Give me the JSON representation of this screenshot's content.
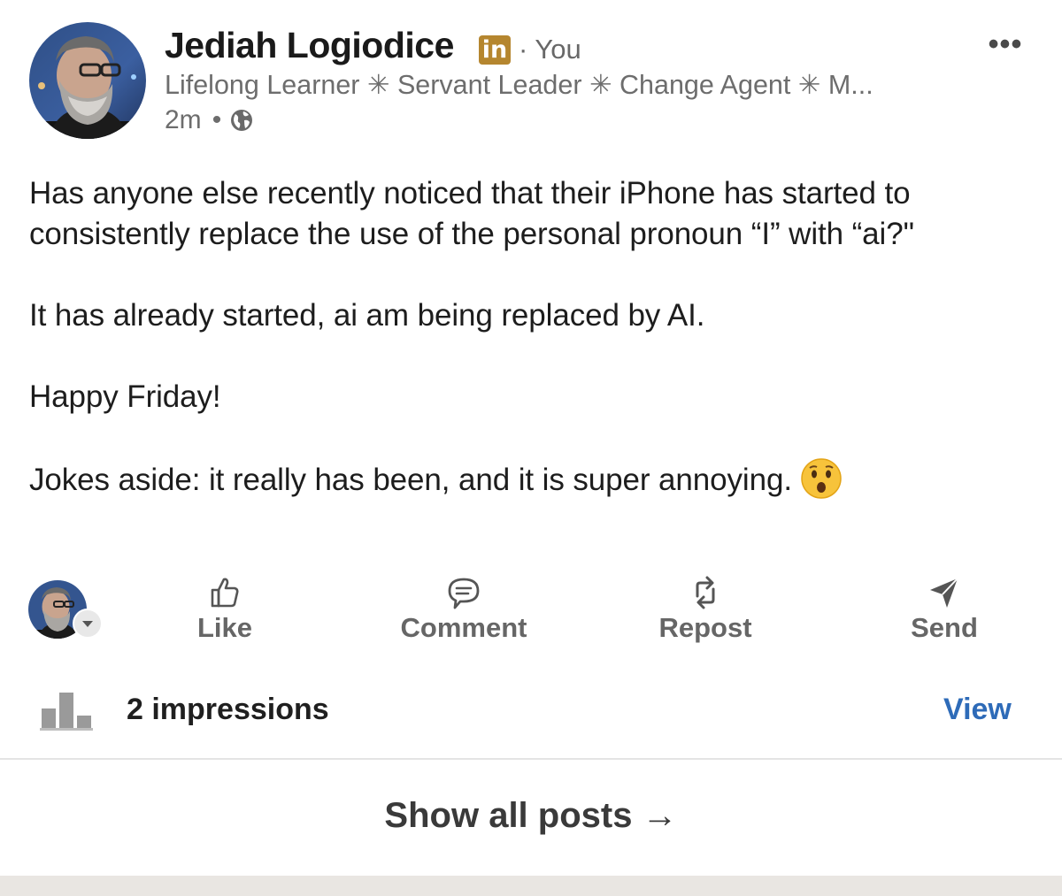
{
  "colors": {
    "premium_badge": "#b5862f",
    "link_blue": "#2e6bb8",
    "muted_text": "#6d6d6d",
    "action_gray": "#666666",
    "footer_band": "#e9e6e2"
  },
  "author": {
    "name": "Jediah Logiodice",
    "badge_text": "in",
    "relation": "· You",
    "headline": "Lifelong Learner ✳ Servant Leader ✳ Change Agent ✳ M...",
    "time": "2m",
    "time_separator": "•",
    "visibility_icon": "globe-icon",
    "avatar_icon": "profile-photo"
  },
  "more_menu": {
    "label": "•••",
    "icon": "more-horizontal-icon"
  },
  "post": {
    "paragraphs": [
      "Has anyone else recently noticed that their iPhone has started to consistently replace the use of the personal pronoun “I” with “ai?\"",
      "It has already started, ai am being replaced by AI.",
      "Happy Friday!",
      "Jokes aside: it really has been, and it is super annoying."
    ],
    "trailing_emoji": "astonished-face-emoji"
  },
  "actions": [
    {
      "label": "Like",
      "icon": "thumbs-up-icon"
    },
    {
      "label": "Comment",
      "icon": "comment-icon"
    },
    {
      "label": "Repost",
      "icon": "repost-icon"
    },
    {
      "label": "Send",
      "icon": "send-icon"
    }
  ],
  "actor_selector": {
    "icon": "caret-down-icon"
  },
  "impressions": {
    "text": "2 impressions",
    "icon": "bar-chart-icon",
    "view_label": "View"
  },
  "footer": {
    "show_all_label": "Show all posts →"
  }
}
